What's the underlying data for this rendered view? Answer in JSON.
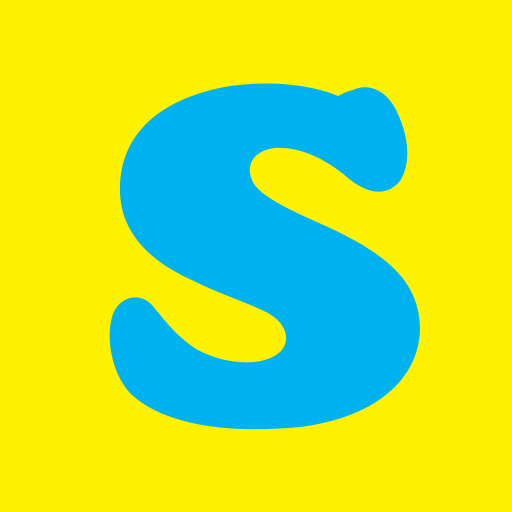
{
  "app_icon": {
    "logo_letter": "S",
    "icon_name": "s-letter-logo-icon",
    "colors": {
      "background": "#FFF200",
      "letter": "#00B3F0"
    }
  }
}
